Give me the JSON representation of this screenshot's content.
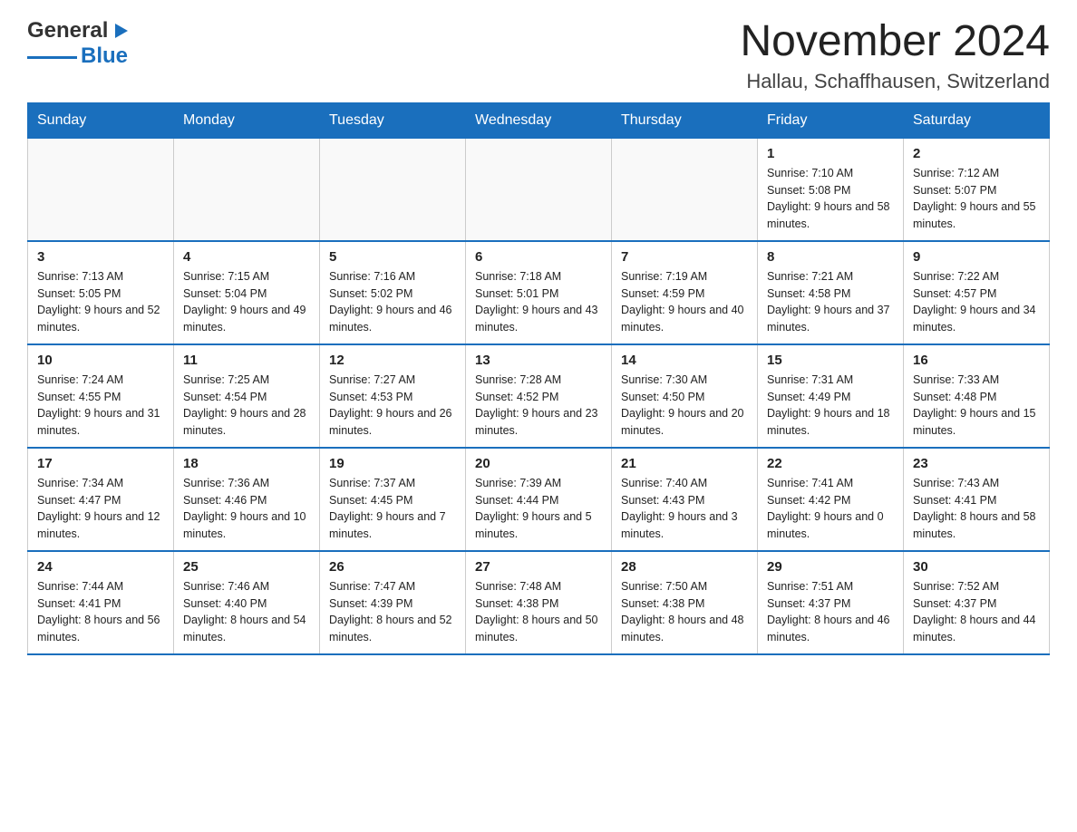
{
  "header": {
    "logo_general": "General",
    "logo_blue": "Blue",
    "title": "November 2024",
    "subtitle": "Hallau, Schaffhausen, Switzerland"
  },
  "calendar": {
    "days_of_week": [
      "Sunday",
      "Monday",
      "Tuesday",
      "Wednesday",
      "Thursday",
      "Friday",
      "Saturday"
    ],
    "weeks": [
      [
        {
          "day": "",
          "info": ""
        },
        {
          "day": "",
          "info": ""
        },
        {
          "day": "",
          "info": ""
        },
        {
          "day": "",
          "info": ""
        },
        {
          "day": "",
          "info": ""
        },
        {
          "day": "1",
          "info": "Sunrise: 7:10 AM\nSunset: 5:08 PM\nDaylight: 9 hours and 58 minutes."
        },
        {
          "day": "2",
          "info": "Sunrise: 7:12 AM\nSunset: 5:07 PM\nDaylight: 9 hours and 55 minutes."
        }
      ],
      [
        {
          "day": "3",
          "info": "Sunrise: 7:13 AM\nSunset: 5:05 PM\nDaylight: 9 hours and 52 minutes."
        },
        {
          "day": "4",
          "info": "Sunrise: 7:15 AM\nSunset: 5:04 PM\nDaylight: 9 hours and 49 minutes."
        },
        {
          "day": "5",
          "info": "Sunrise: 7:16 AM\nSunset: 5:02 PM\nDaylight: 9 hours and 46 minutes."
        },
        {
          "day": "6",
          "info": "Sunrise: 7:18 AM\nSunset: 5:01 PM\nDaylight: 9 hours and 43 minutes."
        },
        {
          "day": "7",
          "info": "Sunrise: 7:19 AM\nSunset: 4:59 PM\nDaylight: 9 hours and 40 minutes."
        },
        {
          "day": "8",
          "info": "Sunrise: 7:21 AM\nSunset: 4:58 PM\nDaylight: 9 hours and 37 minutes."
        },
        {
          "day": "9",
          "info": "Sunrise: 7:22 AM\nSunset: 4:57 PM\nDaylight: 9 hours and 34 minutes."
        }
      ],
      [
        {
          "day": "10",
          "info": "Sunrise: 7:24 AM\nSunset: 4:55 PM\nDaylight: 9 hours and 31 minutes."
        },
        {
          "day": "11",
          "info": "Sunrise: 7:25 AM\nSunset: 4:54 PM\nDaylight: 9 hours and 28 minutes."
        },
        {
          "day": "12",
          "info": "Sunrise: 7:27 AM\nSunset: 4:53 PM\nDaylight: 9 hours and 26 minutes."
        },
        {
          "day": "13",
          "info": "Sunrise: 7:28 AM\nSunset: 4:52 PM\nDaylight: 9 hours and 23 minutes."
        },
        {
          "day": "14",
          "info": "Sunrise: 7:30 AM\nSunset: 4:50 PM\nDaylight: 9 hours and 20 minutes."
        },
        {
          "day": "15",
          "info": "Sunrise: 7:31 AM\nSunset: 4:49 PM\nDaylight: 9 hours and 18 minutes."
        },
        {
          "day": "16",
          "info": "Sunrise: 7:33 AM\nSunset: 4:48 PM\nDaylight: 9 hours and 15 minutes."
        }
      ],
      [
        {
          "day": "17",
          "info": "Sunrise: 7:34 AM\nSunset: 4:47 PM\nDaylight: 9 hours and 12 minutes."
        },
        {
          "day": "18",
          "info": "Sunrise: 7:36 AM\nSunset: 4:46 PM\nDaylight: 9 hours and 10 minutes."
        },
        {
          "day": "19",
          "info": "Sunrise: 7:37 AM\nSunset: 4:45 PM\nDaylight: 9 hours and 7 minutes."
        },
        {
          "day": "20",
          "info": "Sunrise: 7:39 AM\nSunset: 4:44 PM\nDaylight: 9 hours and 5 minutes."
        },
        {
          "day": "21",
          "info": "Sunrise: 7:40 AM\nSunset: 4:43 PM\nDaylight: 9 hours and 3 minutes."
        },
        {
          "day": "22",
          "info": "Sunrise: 7:41 AM\nSunset: 4:42 PM\nDaylight: 9 hours and 0 minutes."
        },
        {
          "day": "23",
          "info": "Sunrise: 7:43 AM\nSunset: 4:41 PM\nDaylight: 8 hours and 58 minutes."
        }
      ],
      [
        {
          "day": "24",
          "info": "Sunrise: 7:44 AM\nSunset: 4:41 PM\nDaylight: 8 hours and 56 minutes."
        },
        {
          "day": "25",
          "info": "Sunrise: 7:46 AM\nSunset: 4:40 PM\nDaylight: 8 hours and 54 minutes."
        },
        {
          "day": "26",
          "info": "Sunrise: 7:47 AM\nSunset: 4:39 PM\nDaylight: 8 hours and 52 minutes."
        },
        {
          "day": "27",
          "info": "Sunrise: 7:48 AM\nSunset: 4:38 PM\nDaylight: 8 hours and 50 minutes."
        },
        {
          "day": "28",
          "info": "Sunrise: 7:50 AM\nSunset: 4:38 PM\nDaylight: 8 hours and 48 minutes."
        },
        {
          "day": "29",
          "info": "Sunrise: 7:51 AM\nSunset: 4:37 PM\nDaylight: 8 hours and 46 minutes."
        },
        {
          "day": "30",
          "info": "Sunrise: 7:52 AM\nSunset: 4:37 PM\nDaylight: 8 hours and 44 minutes."
        }
      ]
    ]
  }
}
